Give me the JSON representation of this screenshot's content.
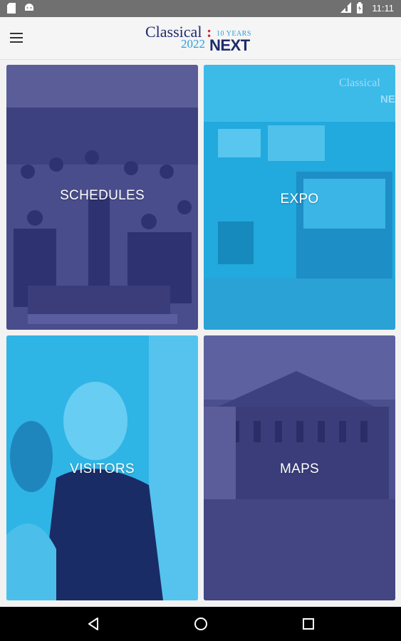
{
  "status_bar": {
    "time": "11:11",
    "left_icons": [
      "sd-card-icon",
      "android-icon"
    ],
    "right_icons": [
      "signal-icon",
      "battery-icon"
    ]
  },
  "app_bar": {
    "menu_icon": "hamburger-menu-icon",
    "logo": {
      "word": "Classical",
      "colon": ":",
      "tagline": "10 YEARS",
      "year": "2022",
      "next": "NEXT"
    }
  },
  "tiles": [
    {
      "label": "SCHEDULES",
      "overlay_color": "#4a4d8c"
    },
    {
      "label": "EXPO",
      "overlay_color": "#22a9dd"
    },
    {
      "label": "VISITORS",
      "overlay_color": "#2fb4e6"
    },
    {
      "label": "MAPS",
      "overlay_color": "#4c4f8e"
    }
  ],
  "expo_banner": {
    "text": "Classical",
    "text2": "NE"
  },
  "nav_bar": {
    "back": "back-triangle-icon",
    "home": "home-circle-icon",
    "recents": "recents-square-icon"
  }
}
